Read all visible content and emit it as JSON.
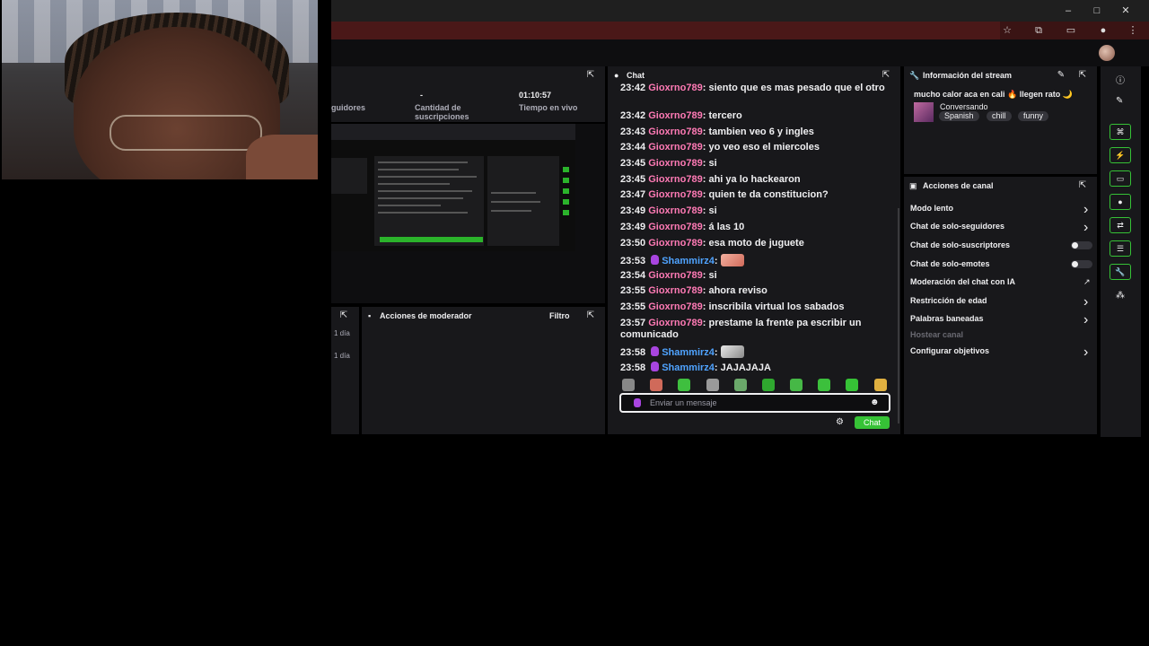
{
  "stats": {
    "followers_label": "guidores",
    "subs_value": "-",
    "subs_label": "Cantidad de suscripciones",
    "live_time_value": "01:10:57",
    "live_time_label": "Tiempo en vivo"
  },
  "mod_actions": {
    "title": "Acciones de moderador",
    "filter_label": "Filtro",
    "left_dates": [
      "1 día",
      "1 día"
    ]
  },
  "chat": {
    "title": "Chat",
    "messages": [
      {
        "time": "23:42",
        "user": "Gioxrno789",
        "text": "siento que es mas pesado que el otro"
      },
      {
        "time": "23:42",
        "user": "Gioxrno789",
        "text": "tercero"
      },
      {
        "time": "23:43",
        "user": "Gioxrno789",
        "text": "tambien veo 6 y ingles"
      },
      {
        "time": "23:44",
        "user": "Gioxrno789",
        "text": "yo veo eso el miercoles"
      },
      {
        "time": "23:45",
        "user": "Gioxrno789",
        "text": "si"
      },
      {
        "time": "23:45",
        "user": "Gioxrno789",
        "text": "ahi ya lo hackearon"
      },
      {
        "time": "23:47",
        "user": "Gioxrno789",
        "text": "quien te da constitucion?"
      },
      {
        "time": "23:49",
        "user": "Gioxrno789",
        "text": "si"
      },
      {
        "time": "23:49",
        "user": "Gioxrno789",
        "text": "á las 10"
      },
      {
        "time": "23:50",
        "user": "Gioxrno789",
        "text": "esa moto de juguete"
      },
      {
        "time": "23:53",
        "user": "Shammirz4",
        "text": ""
      },
      {
        "time": "23:54",
        "user": "Gioxrno789",
        "text": "si"
      },
      {
        "time": "23:55",
        "user": "Gioxrno789",
        "text": "ahora reviso"
      },
      {
        "time": "23:55",
        "user": "Gioxrno789",
        "text": "inscribila virtual los sabados"
      },
      {
        "time": "23:57",
        "user": "Gioxrno789",
        "text": "prestame la frente pa escribir un comunicado"
      },
      {
        "time": "23:58",
        "user": "Shammirz4",
        "text": ""
      },
      {
        "time": "23:58",
        "user": "Shammirz4",
        "text": "JAJAJAJA"
      }
    ],
    "input_placeholder": "Enviar un mensaje",
    "send_label": "Chat"
  },
  "stream_info": {
    "title": "Información del stream",
    "stream_title": "mucho calor aca en cali 🔥 llegen rato 🌙",
    "category": "Conversando",
    "tags": [
      "Spanish",
      "chill",
      "funny"
    ]
  },
  "channel_actions": {
    "title": "Acciones de canal",
    "items": [
      {
        "label": "Modo lento",
        "control": "chevron"
      },
      {
        "label": "Chat de solo-seguidores",
        "control": "chevron"
      },
      {
        "label": "Chat de solo-suscriptores",
        "control": "toggle"
      },
      {
        "label": "Chat de solo-emotes",
        "control": "toggle"
      },
      {
        "label": "Moderación del chat con IA",
        "control": "chart"
      },
      {
        "label": "Restricción de edad",
        "control": "chevron"
      },
      {
        "label": "Palabras baneadas",
        "control": "chevron"
      },
      {
        "label": "Hostear canal",
        "control": "none"
      },
      {
        "label": "Configurar objetivos",
        "control": "chevron"
      }
    ]
  },
  "colors": {
    "accent_green": "#36c236",
    "user_pink": "#ff7ab5",
    "user_blue": "#4fa3ff",
    "panel_bg": "#18181b"
  }
}
